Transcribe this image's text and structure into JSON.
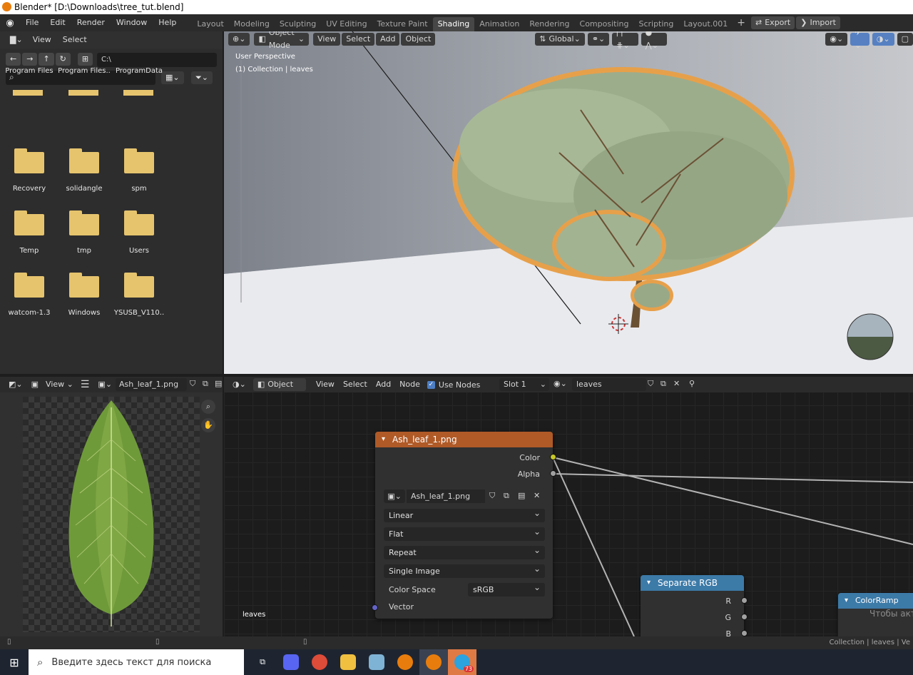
{
  "window": {
    "title": "Blender* [D:\\Downloads\\tree_tut.blend]"
  },
  "menu": [
    "File",
    "Edit",
    "Render",
    "Window",
    "Help"
  ],
  "workspaces": [
    {
      "label": "Layout",
      "active": false
    },
    {
      "label": "Modeling",
      "active": false
    },
    {
      "label": "Sculpting",
      "active": false
    },
    {
      "label": "UV Editing",
      "active": false
    },
    {
      "label": "Texture Paint",
      "active": false
    },
    {
      "label": "Shading",
      "active": true
    },
    {
      "label": "Animation",
      "active": false
    },
    {
      "label": "Rendering",
      "active": false
    },
    {
      "label": "Compositing",
      "active": false
    },
    {
      "label": "Scripting",
      "active": false
    },
    {
      "label": "Layout.001",
      "active": false
    }
  ],
  "addons": {
    "export": "Export",
    "import": "Import",
    "add": "+"
  },
  "filebrowser": {
    "menu_view": "View",
    "menu_select": "Select",
    "path": "C:\\",
    "folders": [
      "Program Files",
      "Program Files..",
      "ProgramData",
      "Recovery",
      "solidangle",
      "spm",
      "Temp",
      "tmp",
      "Users",
      "watcom-1.3",
      "Windows",
      "YSUSB_V110.."
    ]
  },
  "viewport": {
    "mode": "Object Mode",
    "view": "View",
    "select": "Select",
    "add": "Add",
    "object": "Object",
    "transform": "Global",
    "perspective": "User Perspective",
    "collection": "(1) Collection | leaves"
  },
  "imgeditor": {
    "view": "View",
    "image_name": "Ash_leaf_1.png"
  },
  "nodeeditor": {
    "type": "Object",
    "view": "View",
    "select": "Select",
    "add": "Add",
    "node": "Node",
    "use_nodes": "Use Nodes",
    "slot": "Slot 1",
    "material": "leaves",
    "label_bottom": "leaves",
    "image_node": {
      "title": "Ash_leaf_1.png",
      "out_color": "Color",
      "out_alpha": "Alpha",
      "image": "Ash_leaf_1.png",
      "interpolation": "Linear",
      "projection": "Flat",
      "extension": "Repeat",
      "source": "Single Image",
      "colorspace_label": "Color Space",
      "colorspace": "sRGB",
      "in_vector": "Vector"
    },
    "sep_node": {
      "title": "Separate RGB",
      "r": "R",
      "g": "G",
      "b": "B"
    },
    "ramp_node": {
      "title": "ColorRamp",
      "overlay": "Чтобы акт"
    }
  },
  "statusbar": {
    "right": "Collection | leaves | Ve"
  },
  "taskbar": {
    "search_placeholder": "Введите здесь текст для поиска",
    "badge": "73"
  },
  "colors": {
    "accent": "#5680c2",
    "orange": "#e8973a",
    "node_image": "#b05a27",
    "node_converter": "#3c7aa8"
  }
}
